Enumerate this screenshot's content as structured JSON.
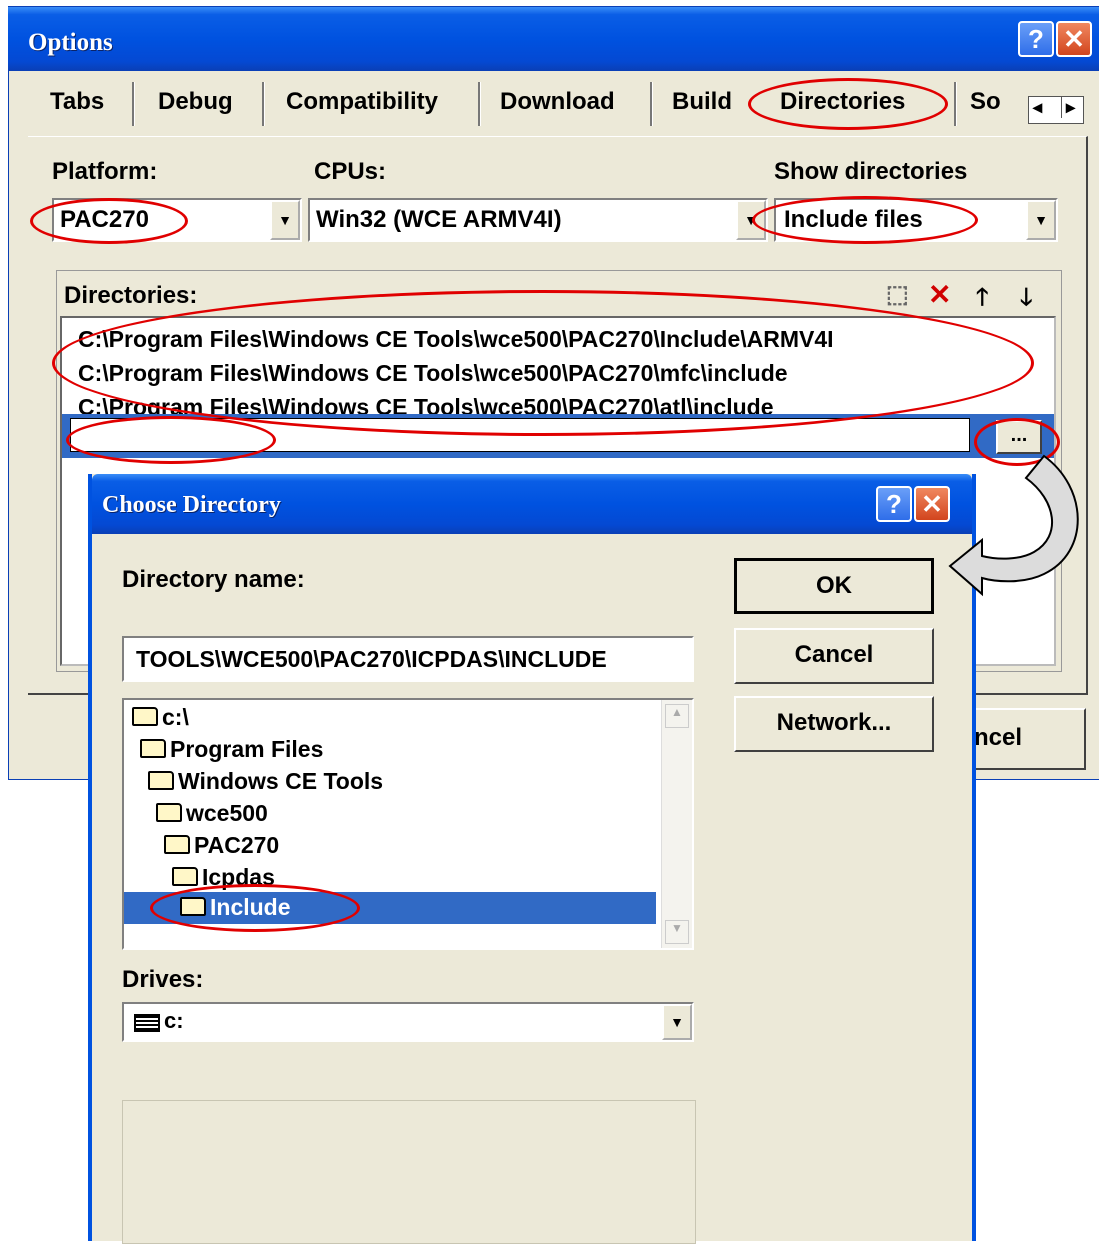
{
  "options_dialog": {
    "title": "Options",
    "help_glyph": "?",
    "close_glyph": "✕",
    "tabs": [
      "Tabs",
      "Debug",
      "Compatibility",
      "Download",
      "Build",
      "Directories",
      "So"
    ],
    "active_tab": "Directories",
    "tab_scroll_left": "◂",
    "tab_scroll_right": "▸",
    "platform_label": "Platform:",
    "platform_value": "PAC270",
    "cpus_label": "CPUs:",
    "cpus_value": "Win32 (WCE ARMV4I)",
    "show_dirs_label": "Show directories",
    "show_dirs_value": "Include files",
    "directories_label": "Directories:",
    "toolbar": {
      "new_glyph": "⬚",
      "delete_glyph": "✕",
      "up_glyph": "🡑",
      "down_glyph": "🡓"
    },
    "directories": [
      "C:\\Program Files\\Windows CE Tools\\wce500\\PAC270\\Include\\ARMV4I",
      "C:\\Program Files\\Windows CE Tools\\wce500\\PAC270\\mfc\\include",
      "C:\\Program Files\\Windows CE Tools\\wce500\\PAC270\\atl\\include"
    ],
    "new_entry_value": "",
    "browse_label": "...",
    "cancel_partial": "ncel"
  },
  "choose_dialog": {
    "title": "Choose Directory",
    "help_glyph": "?",
    "close_glyph": "✕",
    "dirname_label": "Directory name:",
    "dirname_value": "TOOLS\\WCE500\\PAC270\\ICPDAS\\INCLUDE",
    "ok_label": "OK",
    "cancel_label": "Cancel",
    "network_label": "Network...",
    "tree": [
      "c:\\",
      "Program Files",
      "Windows CE Tools",
      "wce500",
      "PAC270",
      "Icpdas",
      "Include"
    ],
    "selected_folder": "Include",
    "drives_label": "Drives:",
    "drive_value": "c:",
    "scroll_up": "▲",
    "scroll_down": "▼"
  },
  "colors": {
    "annotation": "#e00000",
    "selection": "#316ac5",
    "titlebar": "#0052e0",
    "dialog_face": "#ece9d8"
  }
}
